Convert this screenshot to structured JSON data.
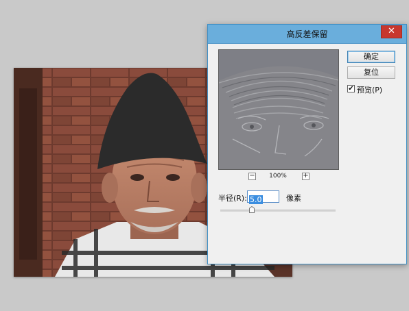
{
  "dialog": {
    "title": "高反差保留",
    "close_symbol": "✕",
    "ok_label": "确定",
    "reset_label": "复位",
    "preview_label": "预览(P)",
    "preview_checked": true,
    "zoom": {
      "out_symbol": "−",
      "in_symbol": "+",
      "value": "100%"
    },
    "radius": {
      "label": "半径(R):",
      "value": "5.0",
      "unit": "像素"
    }
  },
  "icons": [
    "close-icon",
    "zoom-out-icon",
    "zoom-in-icon",
    "checkmark-icon",
    "slider-thumb-icon"
  ],
  "colors": {
    "titlebar": "#6aaedc",
    "close_button": "#c8372e",
    "selection": "#3b8ee0",
    "canvas_background": "#c9c9c9"
  }
}
